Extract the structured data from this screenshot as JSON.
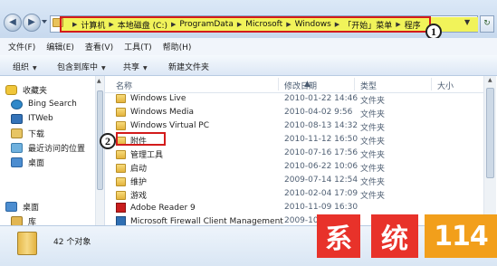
{
  "address": {
    "crumbs": [
      "计算机",
      "本地磁盘 (C:)",
      "ProgramData",
      "Microsoft",
      "Windows",
      "「开始」菜单",
      "程序"
    ],
    "badge": "1"
  },
  "menu": [
    "文件(F)",
    "编辑(E)",
    "查看(V)",
    "工具(T)",
    "帮助(H)"
  ],
  "toolbar": {
    "organize": "组织",
    "include_library": "包含到库中",
    "share": "共享",
    "new_folder": "新建文件夹"
  },
  "nav": {
    "favorites": "收藏夹",
    "items": [
      "Bing Search",
      "ITWeb",
      "下载",
      "最近访问的位置",
      "桌面"
    ],
    "desktop": "桌面",
    "library": "库"
  },
  "columns": {
    "name": "名称",
    "date": "修改日期",
    "type": "类型",
    "size": "大小"
  },
  "rows": [
    {
      "name": "Windows Live",
      "date": "2010-01-22 14:46",
      "type": "文件夹",
      "icon": "folder-icon"
    },
    {
      "name": "Windows Media",
      "date": "2010-04-02 9:56",
      "type": "文件夹",
      "icon": "folder-icon"
    },
    {
      "name": "Windows Virtual PC",
      "date": "2010-08-13 14:32",
      "type": "文件夹",
      "icon": "folder-icon"
    },
    {
      "name": "附件",
      "date": "2010-11-12 16:50",
      "type": "文件夹",
      "icon": "folder-icon"
    },
    {
      "name": "管理工具",
      "date": "2010-07-16 17:56",
      "type": "文件夹",
      "icon": "folder-icon"
    },
    {
      "name": "启动",
      "date": "2010-06-22 10:06",
      "type": "文件夹",
      "icon": "folder-icon"
    },
    {
      "name": "维护",
      "date": "2009-07-14 12:54",
      "type": "文件夹",
      "icon": "folder-icon"
    },
    {
      "name": "游戏",
      "date": "2010-02-04 17:09",
      "type": "文件夹",
      "icon": "folder-icon"
    },
    {
      "name": "Adobe Reader 9",
      "date": "2010-11-09 16:30",
      "type": "",
      "icon": "pdf-icon"
    },
    {
      "name": "Microsoft Firewall Client Management",
      "date": "2009-10-",
      "type": "",
      "icon": "app-icon"
    }
  ],
  "badge2": "2",
  "status": {
    "count": "42 个对象"
  },
  "watermark": [
    "系",
    "统",
    "114"
  ],
  "colors": {
    "highlight": "#f1f35a",
    "callout_red": "#d31b1b",
    "watermark_red": "#e8322a",
    "watermark_orange": "#f29f1b"
  }
}
